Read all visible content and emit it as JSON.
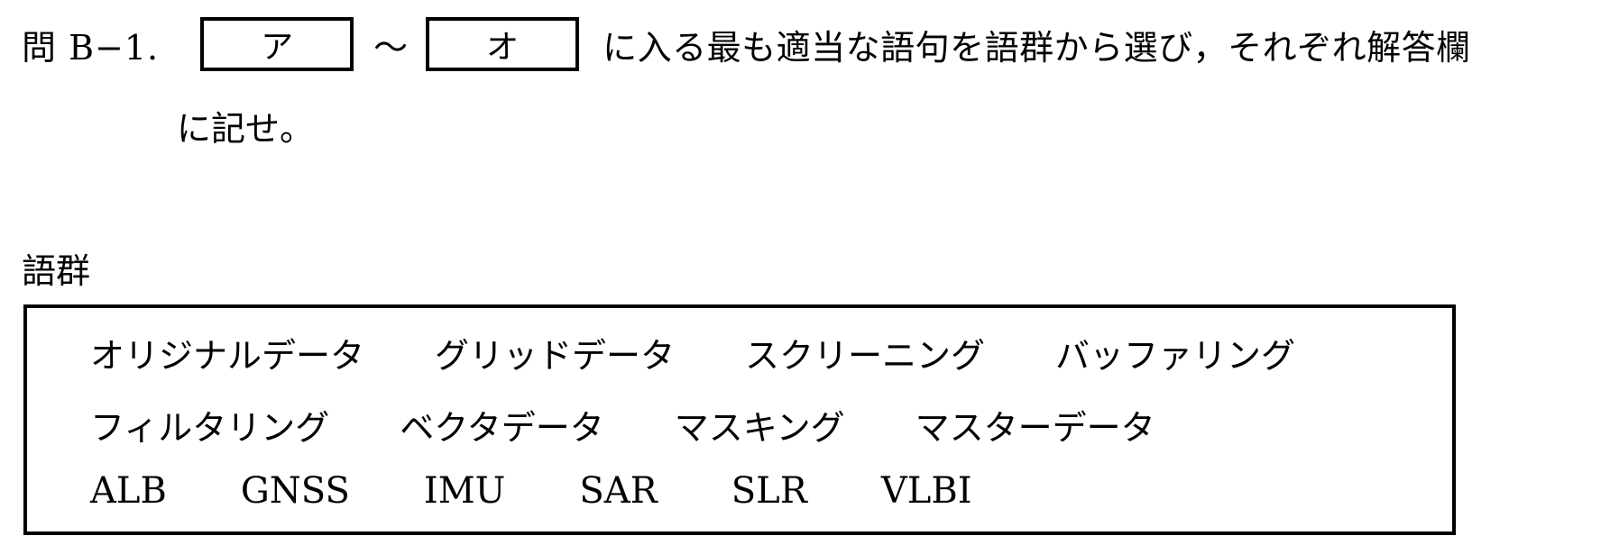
{
  "question": {
    "label": "問 B−1.",
    "blank_start": "ア",
    "tilde": "〜",
    "blank_end": "オ",
    "text_line1": "に入る最も適当な語句を語群から選び，それぞれ解答欄",
    "text_line2": "に記せ。"
  },
  "word_bank": {
    "title": "語群",
    "rows": [
      [
        "オリジナルデータ",
        "グリッドデータ",
        "スクリーニング",
        "バッファリング"
      ],
      [
        "フィルタリング",
        "ベクタデータ",
        "マスキング",
        "マスターデータ"
      ],
      [
        "ALB",
        "GNSS",
        "IMU",
        "SAR",
        "SLR",
        "VLBI"
      ]
    ]
  }
}
